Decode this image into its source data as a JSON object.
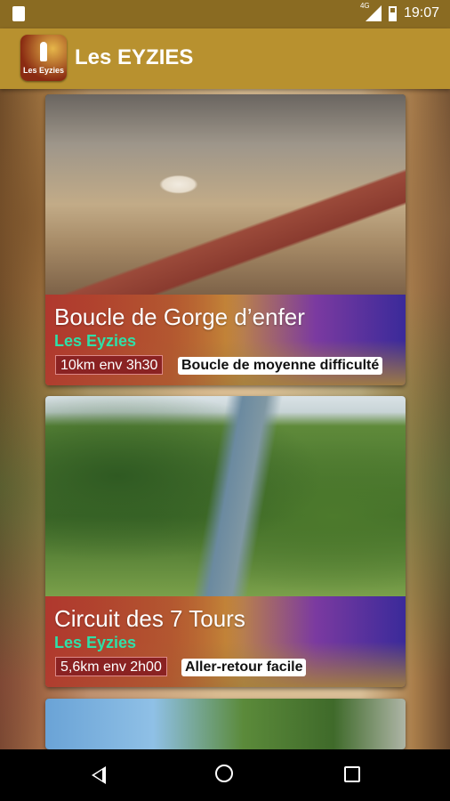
{
  "status_bar": {
    "time": "19:07",
    "network": "4G"
  },
  "app_bar": {
    "title": "Les EYZIES",
    "logo_text": "Les Eyzies"
  },
  "trails": [
    {
      "name": "Boucle de Gorge d’enfer",
      "place": "Les Eyzies",
      "distance": "10km env 3h30",
      "difficulty": "Boucle de moyenne difficulté"
    },
    {
      "name": "Circuit des 7 Tours",
      "place": "Les Eyzies",
      "distance": "5,6km env 2h00",
      "difficulty": "Aller-retour facile"
    }
  ],
  "nav": {
    "back_icon": "back-triangle",
    "home_icon": "home-circle",
    "recents_icon": "recents-square"
  },
  "colors": {
    "app_bar": "#b8912f",
    "status_bar": "#8a6b22",
    "place_text": "#2fe0a8",
    "distance_badge": "#8a2222"
  }
}
